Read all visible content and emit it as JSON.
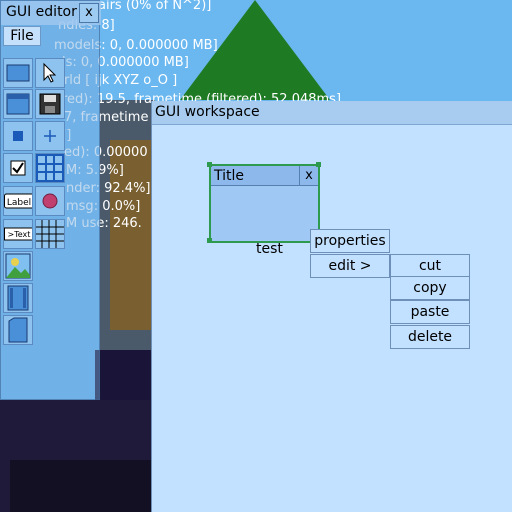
{
  "debug_overlay": {
    "lines": [
      "airs (0% of N^2)]",
      "ndles: 8]",
      "models: 0, 0.000000 MB]",
      "els: 0, 0.000000 MB]",
      "orld [ ijk XYZ o_O ]",
      "red): 19.5, frametime (filtered): 52.048ms]",
      "7, frametime",
      "7]",
      "ed): 0.00000",
      "M: 5.9%]",
      "nder: 92.4%]",
      "msg: 0.0%]",
      "M use: 246."
    ]
  },
  "editor": {
    "title": "GUI editor",
    "close_label": "x",
    "file_menu_label": "File",
    "tool_label_text": "Label",
    "tool_text_text": ">Text"
  },
  "workspace": {
    "title": "GUI workspace",
    "sample_window": {
      "title": "Title",
      "close_label": "x"
    },
    "sample_label": "test",
    "context_menu": {
      "properties": "properties",
      "edit": "edit >"
    },
    "edit_submenu": {
      "cut": "cut",
      "copy": "copy",
      "paste": "paste",
      "delete": "delete"
    }
  },
  "colors": {
    "sky": "#6bb8f0",
    "mountain": "#1f7a24",
    "workspace_bg": "#c2e0ff",
    "selection": "#2e9a4e"
  }
}
